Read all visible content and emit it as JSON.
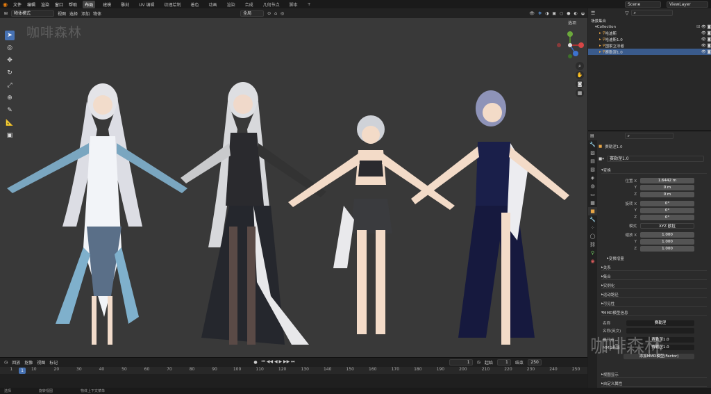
{
  "menu": [
    "文件",
    "编辑",
    "渲染",
    "窗口",
    "帮助"
  ],
  "workspaces": [
    "布局",
    "建模",
    "雕刻",
    "UV 编辑",
    "纹理绘制",
    "着色",
    "动画",
    "渲染",
    "合成",
    "几何节点",
    "脚本"
  ],
  "workspace_add": "+",
  "scene": "Scene",
  "view_layer": "ViewLayer",
  "viewport_header": {
    "mode": "物体模式",
    "menus": [
      "视图",
      "选择",
      "添加",
      "物体"
    ],
    "transform": "全局"
  },
  "viewport": {
    "options": "选项",
    "watermark": "咖啡森林"
  },
  "outliner": {
    "scene_collection": "场景集合",
    "collection": "Collection",
    "items": [
      "哈迪斯",
      "哈迪斯1.0",
      "国家立法者",
      "赛勒涅1.0"
    ],
    "selected_index": 3
  },
  "properties": {
    "object_name": "赛勒涅1.0",
    "data_name": "赛勒涅1.0",
    "transform_title": "变换",
    "location": {
      "label": "位置 X",
      "x": "1.6442 m",
      "y": "0 m",
      "z": "0 m"
    },
    "rotation": {
      "label": "旋转 X",
      "x": "0°",
      "y": "0°",
      "z": "0°"
    },
    "mode_label": "模式",
    "mode_value": "XYZ 欧拉",
    "scale": {
      "label": "缩放 X",
      "x": "1.000",
      "y": "1.000",
      "z": "1.000"
    },
    "axis_y": "Y",
    "axis_z": "Z",
    "delta": "变换增量",
    "sections": [
      "关系",
      "集合",
      "实例化",
      "运动路径",
      "可见性"
    ],
    "mmd_title": "MMD模型信息",
    "mmd_name_label": "名称",
    "mmd_name_value": "赛勒涅",
    "mmd_name_en_label": "名称(英文)",
    "mmd_root_label": "根节点",
    "mmd_root_value": "赛勒涅1.0",
    "mmd_bone_label": "MMD骨骼",
    "mmd_bone_value": "赛勒涅1.0",
    "mmd_scale_btn": "添加MMD模型(Factor)",
    "bottom_sections": [
      "视图显示",
      "自定义属性"
    ],
    "watermark": "咖啡森林"
  },
  "timeline": {
    "menus": [
      "回放",
      "抠像",
      "视图",
      "标记"
    ],
    "current_frame": "1",
    "start_label": "起始",
    "start": "1",
    "end_label": "结束",
    "end": "250",
    "ticks": [
      "1",
      "10",
      "20",
      "30",
      "40",
      "50",
      "60",
      "70",
      "80",
      "90",
      "100",
      "110",
      "120",
      "130",
      "140",
      "150",
      "160",
      "170",
      "180",
      "190",
      "200",
      "210",
      "220",
      "230",
      "240",
      "250"
    ]
  },
  "status": {
    "select": "选择",
    "rotate": "旋转视图",
    "context": "物体上下文菜单"
  }
}
